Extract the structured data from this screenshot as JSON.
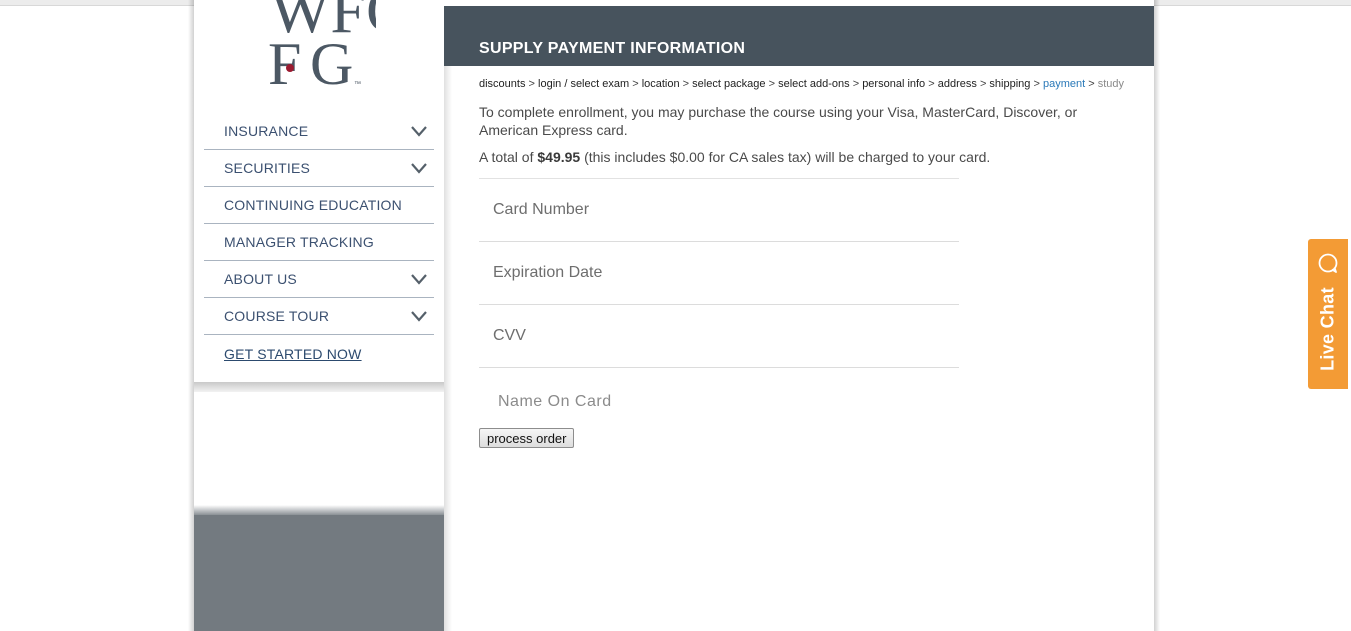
{
  "sidebar": {
    "logo": {
      "text": "WFG",
      "trademark": "™",
      "dot_color": "#9b1b30"
    },
    "nav": [
      {
        "label": "INSURANCE",
        "has_dropdown": true
      },
      {
        "label": "SECURITIES",
        "has_dropdown": true
      },
      {
        "label": "CONTINUING EDUCATION",
        "has_dropdown": false
      },
      {
        "label": "MANAGER TRACKING",
        "has_dropdown": false
      },
      {
        "label": "ABOUT US",
        "has_dropdown": true
      },
      {
        "label": "COURSE TOUR",
        "has_dropdown": true
      },
      {
        "label": "GET STARTED NOW",
        "has_dropdown": false
      }
    ]
  },
  "header": {
    "title": "SUPPLY PAYMENT INFORMATION"
  },
  "breadcrumb": {
    "steps": [
      "discounts",
      "login / select exam",
      "location",
      "select package",
      "select add-ons",
      "personal info",
      "address",
      "shipping",
      "payment",
      "study"
    ],
    "separator": ">",
    "active": "payment"
  },
  "content": {
    "intro": "To complete enrollment, you may purchase the course using your Visa, MasterCard, Discover, or American Express card.",
    "total_prefix": "A total of ",
    "total_amount": "$49.95",
    "total_suffix": " (this includes $0.00 for CA sales tax) will be charged to your card."
  },
  "form": {
    "card_number_placeholder": "Card Number",
    "expiration_placeholder": "Expiration Date",
    "cvv_placeholder": "CVV",
    "name_placeholder": "Name On Card",
    "submit_label": "process order"
  },
  "live_chat": {
    "label": "Live Chat",
    "icon": "chat-bubble-icon",
    "color": "#f39b35"
  },
  "colors": {
    "header_bg": "#47535d",
    "nav_text": "#3b5070",
    "sidebar_footer": "#737a80"
  }
}
